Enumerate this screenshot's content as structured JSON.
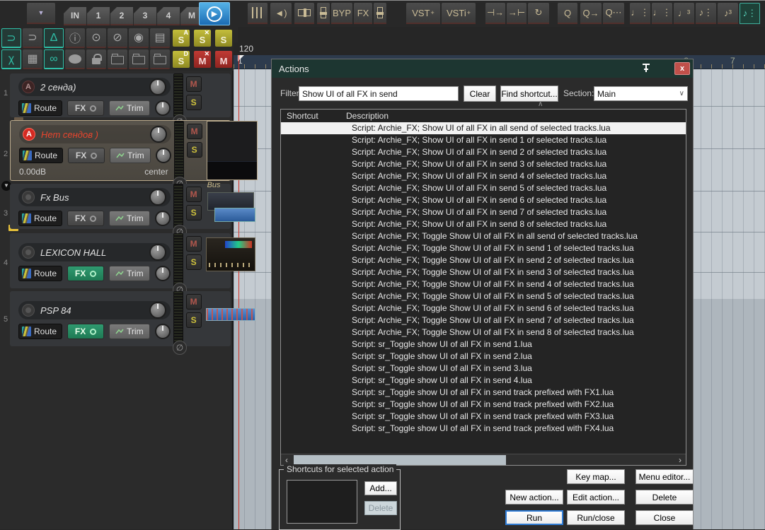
{
  "colors": {
    "accent_teal": "#2fbfa7",
    "dialog_title_bg": "#1d3631",
    "close_red": "#c0504a",
    "selected_row_bg": "#f2f2f2",
    "edit_cursor_red": "#d23227",
    "solo_yellow": "#c3bd3c",
    "mute_red": "#c03a34"
  },
  "toolbar_top": {
    "dropdown": {
      "name": "toolbar-dropdown",
      "glyph": "▼"
    },
    "tabs": [
      "IN",
      "1",
      "2",
      "3",
      "4",
      "M"
    ],
    "play_glyph": "▶",
    "icons_mid": [
      {
        "name": "mixer-icon",
        "glyph": "",
        "cls": "bars"
      },
      {
        "name": "speaker-pair-icon",
        "glyph": "◄)"
      },
      {
        "name": "fader-horizontal-icon",
        "glyph": "",
        "cls": "hfader"
      },
      {
        "name": "fader-vertical-icon",
        "glyph": "",
        "cls": "vfader"
      },
      {
        "name": "bypass-button",
        "glyph": "BYP"
      },
      {
        "name": "fx-button",
        "glyph": "FX"
      },
      {
        "name": "fader-vertical2-icon",
        "glyph": "",
        "cls": "vfader"
      }
    ],
    "vst": {
      "label": "VST",
      "sup": "+"
    },
    "vsti": {
      "label": "VSTi",
      "sup": "+"
    },
    "icons_right": [
      {
        "name": "move-cursor-left-icon",
        "glyph": "⊣→"
      },
      {
        "name": "move-cursor-right-icon",
        "glyph": "→⊢"
      },
      {
        "name": "loop-icon",
        "glyph": "↻"
      },
      {
        "name": "quantize-icon",
        "glyph": "Q"
      },
      {
        "name": "quantize-move-icon",
        "glyph": "Q→"
      },
      {
        "name": "quantize-dots-icon",
        "glyph": "Q⋯"
      }
    ],
    "notes": [
      {
        "name": "note-grid-quarter-icon",
        "glyph": "♩⋮"
      },
      {
        "name": "note-quarter-icon",
        "glyph": "♩⋮"
      },
      {
        "name": "note-triplet-icon",
        "glyph": "♩³"
      },
      {
        "name": "note-eighth-icon",
        "glyph": "♪⋮"
      },
      {
        "name": "note-eighth-triplet-icon",
        "glyph": "♪³"
      },
      {
        "name": "note-grid-active-icon",
        "glyph": "♪⋮",
        "active": true
      }
    ]
  },
  "toolbar_left": {
    "row1": [
      {
        "name": "snap-magnet-icon",
        "glyph": "⊃",
        "teal": true
      },
      {
        "name": "magnet-arrows-icon",
        "glyph": "⊃"
      },
      {
        "name": "dome-icon",
        "glyph": "∆",
        "teal": true
      },
      {
        "name": "info-icon",
        "glyph": "ⓘ"
      },
      {
        "name": "eye-frame-icon",
        "glyph": "⊙"
      },
      {
        "name": "eye-off-icon",
        "glyph": "⊘"
      },
      {
        "name": "eye-icon",
        "glyph": "◉"
      },
      {
        "name": "list-icon",
        "glyph": "▤"
      }
    ],
    "row1_badges": [
      {
        "name": "solo-a-badge",
        "label": "S",
        "sup": "A",
        "cls": "y"
      },
      {
        "name": "solo-x-badge",
        "label": "S",
        "sup": "✕",
        "cls": "y"
      },
      {
        "name": "solo-badge",
        "label": "S",
        "sup": "",
        "cls": "y"
      }
    ],
    "row2": [
      {
        "name": "crossfade-icon",
        "glyph": "χ",
        "teal": true
      },
      {
        "name": "grid-icon",
        "glyph": "▦"
      },
      {
        "name": "link-icon",
        "glyph": "∞",
        "teal": true
      },
      {
        "name": "speech-bubble-icon",
        "glyph": "",
        "cls": "bubble"
      },
      {
        "name": "lock-icon",
        "glyph": "",
        "cls": "lock"
      },
      {
        "name": "folder-check-icon",
        "glyph": "",
        "cls": "folder"
      },
      {
        "name": "folder-stack-icon",
        "glyph": "",
        "cls": "folder"
      },
      {
        "name": "folder-open-icon",
        "glyph": "",
        "cls": "folder"
      }
    ],
    "row2_badges": [
      {
        "name": "solo-d-badge",
        "label": "S",
        "sup": "D",
        "cls": "y"
      },
      {
        "name": "mute-x-badge",
        "label": "M",
        "sup": "✕",
        "cls": "r"
      },
      {
        "name": "mute-badge",
        "label": "M",
        "sup": "",
        "cls": "r"
      }
    ]
  },
  "ruler": {
    "tempo": "120",
    "n1": "1",
    "n3": ".3",
    "n7": "7"
  },
  "tracks": [
    {
      "num": "1",
      "badge": "A",
      "name": "2 сенда)",
      "route": "Route",
      "fx": "FX",
      "trim": "Trim",
      "mute": "M",
      "solo": "S",
      "phase": "∅"
    },
    {
      "num": "2",
      "badge": "A",
      "name": "Нет сендов )",
      "route": "Route",
      "fx": "FX",
      "trim": "Trim",
      "mute": "M",
      "solo": "S",
      "phase": "∅",
      "vol": "0.00dB",
      "pan": "center"
    },
    {
      "num": "3",
      "badge": "",
      "name": "Fx Bus",
      "route": "Route",
      "fx": "FX",
      "trim": "Trim",
      "mute": "M",
      "solo": "S",
      "phase": "∅",
      "bus_label": "Bus"
    },
    {
      "num": "4",
      "badge": "",
      "name": "LEXICON HALL",
      "route": "Route",
      "fx": "FX",
      "trim": "Trim",
      "mute": "M",
      "solo": "S",
      "phase": "∅"
    },
    {
      "num": "5",
      "badge": "",
      "name": "PSP 84",
      "route": "Route",
      "fx": "FX",
      "trim": "Trim",
      "mute": "M",
      "solo": "S",
      "phase": "∅"
    }
  ],
  "dialog": {
    "title": "Actions",
    "close_glyph": "x",
    "filter_label": "Filter:",
    "filter_value": "Show UI of all FX in send",
    "clear": "Clear",
    "find_shortcut": "Find shortcut...",
    "section_label": "Section:",
    "section_value": "Main",
    "section_chevron": "∨",
    "list_chevron": "∧",
    "col_shortcut": "Shortcut",
    "col_description": "Description",
    "selected_index": 0,
    "actions": [
      "Script: Archie_FX; Show UI of all FX in all send of selected tracks.lua",
      "Script: Archie_FX; Show UI of all FX in send 1 of selected tracks.lua",
      "Script: Archie_FX; Show UI of all FX in send 2 of selected tracks.lua",
      "Script: Archie_FX; Show UI of all FX in send 3 of selected tracks.lua",
      "Script: Archie_FX; Show UI of all FX in send 4 of selected tracks.lua",
      "Script: Archie_FX; Show UI of all FX in send 5 of selected tracks.lua",
      "Script: Archie_FX; Show UI of all FX in send 6 of selected tracks.lua",
      "Script: Archie_FX; Show UI of all FX in send 7 of selected tracks.lua",
      "Script: Archie_FX; Show UI of all FX in send 8 of selected tracks.lua",
      "Script: Archie_FX; Toggle Show UI of all FX in all send of selected tracks.lua",
      "Script: Archie_FX; Toggle Show UI of all FX in send 1 of selected tracks.lua",
      "Script: Archie_FX; Toggle Show UI of all FX in send 2 of selected tracks.lua",
      "Script: Archie_FX; Toggle Show UI of all FX in send 3 of selected tracks.lua",
      "Script: Archie_FX; Toggle Show UI of all FX in send 4 of selected tracks.lua",
      "Script: Archie_FX; Toggle Show UI of all FX in send 5 of selected tracks.lua",
      "Script: Archie_FX; Toggle Show UI of all FX in send 6 of selected tracks.lua",
      "Script: Archie_FX; Toggle Show UI of all FX in send 7 of selected tracks.lua",
      "Script: Archie_FX; Toggle Show UI of all FX in send 8 of selected tracks.lua",
      "Script: sr_Toggle show UI of all FX in send 1.lua",
      "Script: sr_Toggle show UI of all FX in send 2.lua",
      "Script: sr_Toggle show UI of all FX in send 3.lua",
      "Script: sr_Toggle show UI of all FX in send 4.lua",
      "Script: sr_Toggle show UI of all FX in send track prefixed with FX1.lua",
      "Script: sr_Toggle show UI of all FX in send track prefixed with FX2.lua",
      "Script: sr_Toggle show UI of all FX in send track prefixed with FX3.lua",
      "Script: sr_Toggle show UI of all FX in send track prefixed with FX4.lua"
    ],
    "scroll_left": "‹",
    "scroll_right": "›",
    "group_label": "Shortcuts for selected action",
    "add": "Add...",
    "delete_disabled": "Delete",
    "buttons": {
      "key_map": "Key map...",
      "menu_editor": "Menu editor...",
      "new_action": "New action...",
      "edit_action": "Edit action...",
      "delete": "Delete",
      "run": "Run",
      "run_close": "Run/close",
      "close": "Close"
    }
  }
}
